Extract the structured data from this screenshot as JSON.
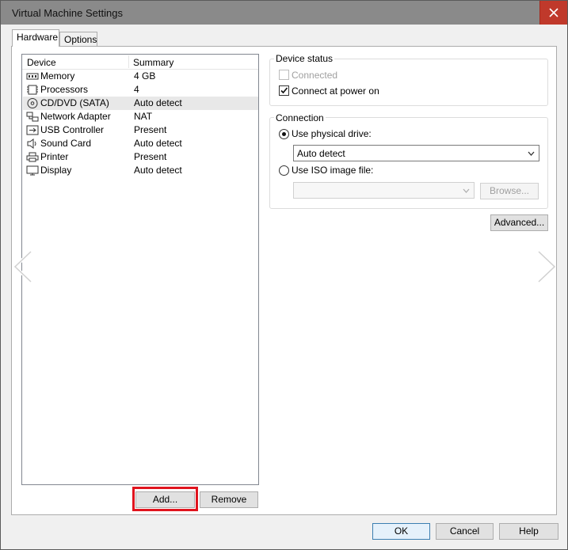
{
  "window": {
    "title": "Virtual Machine Settings"
  },
  "tabs": [
    {
      "label": "Hardware"
    },
    {
      "label": "Options"
    }
  ],
  "device_list": {
    "columns": [
      "Device",
      "Summary"
    ],
    "rows": [
      {
        "device": "Memory",
        "summary": "4 GB",
        "icon": "memory-icon"
      },
      {
        "device": "Processors",
        "summary": "4",
        "icon": "processor-icon"
      },
      {
        "device": "CD/DVD (SATA)",
        "summary": "Auto detect",
        "icon": "cd-dvd-icon",
        "selected": true
      },
      {
        "device": "Network Adapter",
        "summary": "NAT",
        "icon": "network-adapter-icon"
      },
      {
        "device": "USB Controller",
        "summary": "Present",
        "icon": "usb-icon"
      },
      {
        "device": "Sound Card",
        "summary": "Auto detect",
        "icon": "speaker-icon"
      },
      {
        "device": "Printer",
        "summary": "Present",
        "icon": "printer-icon"
      },
      {
        "device": "Display",
        "summary": "Auto detect",
        "icon": "monitor-icon"
      }
    ]
  },
  "list_buttons": {
    "add": "Add...",
    "remove": "Remove"
  },
  "device_status": {
    "label": "Device status",
    "connected": {
      "label": "Connected",
      "checked": false,
      "disabled": true
    },
    "connect_at_power_on": {
      "label": "Connect at power on",
      "checked": true
    }
  },
  "connection": {
    "label": "Connection",
    "use_physical_drive": {
      "label": "Use physical drive:",
      "selected": true
    },
    "physical_drive_value": "Auto detect",
    "use_iso_image": {
      "label": "Use ISO image file:",
      "selected": false
    },
    "iso_value": "",
    "browse_label": "Browse..."
  },
  "advanced_label": "Advanced...",
  "footer": {
    "ok": "OK",
    "cancel": "Cancel",
    "help": "Help"
  },
  "colors": {
    "highlight": "#e0141e",
    "close": "#c0392b",
    "titlebar": "#8a8a8a"
  }
}
